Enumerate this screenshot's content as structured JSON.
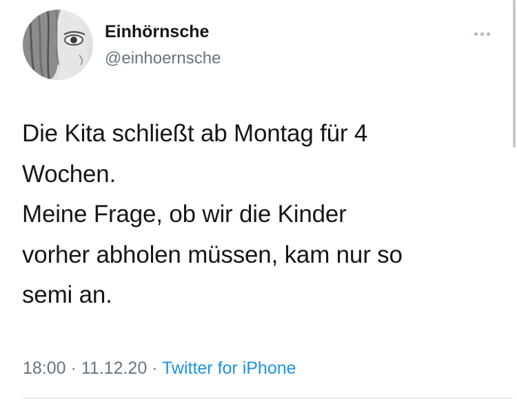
{
  "author": {
    "display_name": "Einhörnsche",
    "handle": "@einhoernsche",
    "avatar": "profile-photo"
  },
  "tweet": {
    "lines": [
      "Die Kita schließt ab Montag für 4",
      "Wochen.",
      "Meine Frage, ob wir die Kinder",
      "vorher abholen müssen, kam nur so",
      "semi an."
    ]
  },
  "meta": {
    "time": "18:00",
    "separator": " · ",
    "date": "11.12.20",
    "source": "Twitter for iPhone"
  },
  "icons": {
    "more": "more-options-icon"
  },
  "colors": {
    "name": "#14171a",
    "secondary": "#66757f",
    "link": "#1b95e0",
    "more_dots": "#aab8c2"
  }
}
